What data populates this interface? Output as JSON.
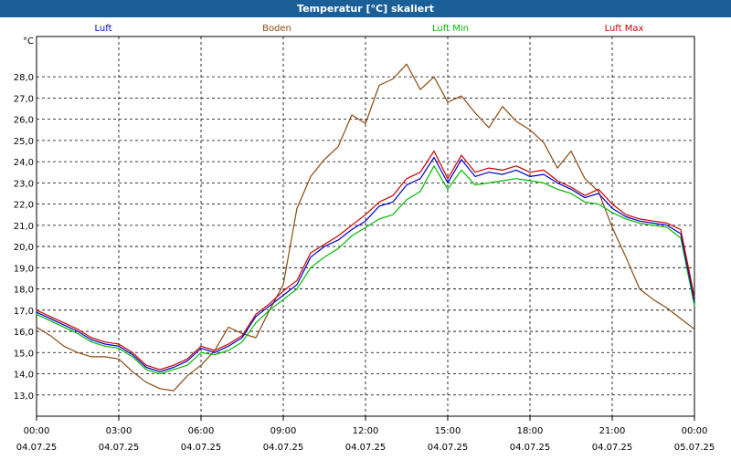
{
  "window": {
    "title": "Temperatur [°C] skaliert"
  },
  "chart_data": {
    "type": "line",
    "title": "Temperatur [°C] skaliert",
    "ylabel": "°C",
    "ylim": [
      12.0,
      29.9
    ],
    "xlim": [
      0,
      24
    ],
    "grid": true,
    "legend_placement": "top",
    "y_ticks": [
      "13,0",
      "14,0",
      "15,0",
      "16,0",
      "17,0",
      "18,0",
      "19,0",
      "20,0",
      "21,0",
      "22,0",
      "23,0",
      "24,0",
      "25,0",
      "26,0",
      "27,0",
      "28,0"
    ],
    "x_ticks": [
      {
        "time": "00:00",
        "date": "04.07.25"
      },
      {
        "time": "03:00",
        "date": "04.07.25"
      },
      {
        "time": "06:00",
        "date": "04.07.25"
      },
      {
        "time": "09:00",
        "date": "04.07.25"
      },
      {
        "time": "12:00",
        "date": "04.07.25"
      },
      {
        "time": "15:00",
        "date": "04.07.25"
      },
      {
        "time": "18:00",
        "date": "04.07.25"
      },
      {
        "time": "21:00",
        "date": "04.07.25"
      },
      {
        "time": "00:00",
        "date": "05.07.25"
      }
    ],
    "x_hours": [
      0,
      0.5,
      1,
      1.5,
      2,
      2.5,
      3,
      3.5,
      4,
      4.5,
      5,
      5.5,
      6,
      6.5,
      7,
      7.5,
      8,
      8.5,
      9,
      9.5,
      10,
      10.5,
      11,
      11.5,
      12,
      12.5,
      13,
      13.5,
      14,
      14.5,
      15,
      15.5,
      16,
      16.5,
      17,
      17.5,
      18,
      18.5,
      19,
      19.5,
      20,
      20.5,
      21,
      21.5,
      22,
      22.5,
      23,
      23.5,
      24
    ],
    "series": [
      {
        "name": "Luft",
        "color": "#0000cc",
        "values": [
          16.9,
          16.6,
          16.3,
          16.0,
          15.6,
          15.4,
          15.3,
          14.9,
          14.3,
          14.1,
          14.3,
          14.6,
          15.2,
          15.0,
          15.3,
          15.7,
          16.7,
          17.2,
          17.7,
          18.2,
          19.5,
          20.0,
          20.3,
          20.8,
          21.2,
          21.9,
          22.1,
          22.9,
          23.2,
          24.2,
          23.0,
          24.1,
          23.3,
          23.5,
          23.4,
          23.6,
          23.3,
          23.4,
          23.0,
          22.7,
          22.3,
          22.5,
          21.8,
          21.4,
          21.2,
          21.1,
          21.0,
          20.6,
          17.4
        ]
      },
      {
        "name": "Boden",
        "color": "#8b4a10",
        "values": [
          16.2,
          15.8,
          15.3,
          15.0,
          14.8,
          14.8,
          14.7,
          14.1,
          13.6,
          13.3,
          13.2,
          13.9,
          14.4,
          15.1,
          16.2,
          15.9,
          15.7,
          17.0,
          18.2,
          21.8,
          23.3,
          24.1,
          24.7,
          26.2,
          25.8,
          27.6,
          27.9,
          28.6,
          27.4,
          28.0,
          26.8,
          27.1,
          26.3,
          25.6,
          26.6,
          25.9,
          25.5,
          24.9,
          23.7,
          24.5,
          23.2,
          22.6,
          20.9,
          19.5,
          18.0,
          17.5,
          17.1,
          16.6,
          16.1
        ]
      },
      {
        "name": "Luft Min",
        "color": "#00bb00",
        "values": [
          16.8,
          16.5,
          16.2,
          15.9,
          15.5,
          15.3,
          15.2,
          14.8,
          14.2,
          14.0,
          14.2,
          14.4,
          15.0,
          14.9,
          15.1,
          15.5,
          16.4,
          17.0,
          17.5,
          18.0,
          19.0,
          19.5,
          19.9,
          20.5,
          20.9,
          21.3,
          21.5,
          22.2,
          22.6,
          23.8,
          22.7,
          23.6,
          22.9,
          23.0,
          23.1,
          23.2,
          23.1,
          23.0,
          22.7,
          22.5,
          22.1,
          22.0,
          21.6,
          21.3,
          21.1,
          21.0,
          20.9,
          20.4,
          17.2
        ]
      },
      {
        "name": "Luft Max",
        "color": "#cc0000",
        "values": [
          17.0,
          16.7,
          16.4,
          16.1,
          15.7,
          15.5,
          15.4,
          15.0,
          14.4,
          14.2,
          14.4,
          14.7,
          15.3,
          15.1,
          15.4,
          15.8,
          16.8,
          17.3,
          17.9,
          18.4,
          19.7,
          20.1,
          20.5,
          21.0,
          21.5,
          22.1,
          22.4,
          23.2,
          23.5,
          24.5,
          23.2,
          24.3,
          23.5,
          23.7,
          23.6,
          23.8,
          23.5,
          23.6,
          23.1,
          22.8,
          22.4,
          22.7,
          22.0,
          21.5,
          21.3,
          21.2,
          21.1,
          20.8,
          17.6
        ]
      }
    ]
  }
}
